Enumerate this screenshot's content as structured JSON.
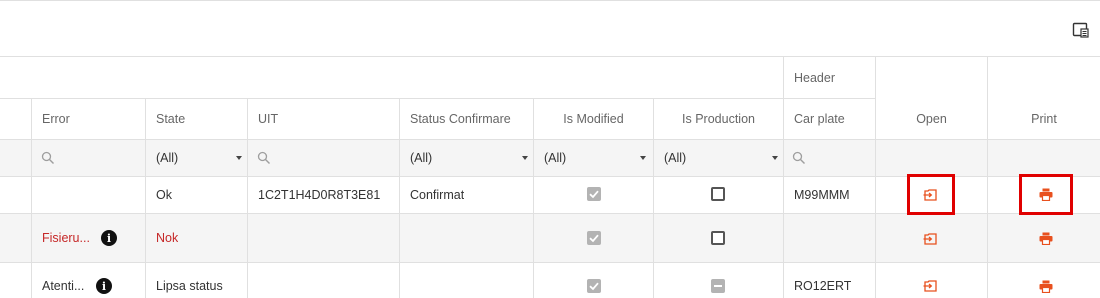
{
  "toolbar": {
    "column_chooser_icon": "column-chooser-icon"
  },
  "columns": {
    "group_header": "Header",
    "error": "Error",
    "state": "State",
    "uit": "UIT",
    "status_confirmare": "Status Confirmare",
    "is_modified": "Is Modified",
    "is_production": "Is Production",
    "car_plate": "Car plate",
    "open": "Open",
    "print": "Print"
  },
  "filters": {
    "state": "(All)",
    "status_confirmare": "(All)",
    "is_modified": "(All)",
    "is_production": "(All)"
  },
  "rows": [
    {
      "error": "",
      "state": "Ok",
      "uit": "1C2T1H4D0R8T3E81",
      "status_confirmare": "Confirmat",
      "is_modified": "checked",
      "is_production": "unchecked",
      "car_plate": "M99MMM",
      "highlighted": true
    },
    {
      "error": "Fisieru...",
      "state": "Nok",
      "uit": "",
      "status_confirmare": "",
      "is_modified": "checked",
      "is_production": "unchecked",
      "car_plate": "",
      "highlighted": false
    },
    {
      "error": "Atenti...",
      "state": "Lipsa status",
      "uit": "",
      "status_confirmare": "",
      "is_modified": "checked",
      "is_production": "indeterminate",
      "car_plate": "RO12ERT",
      "highlighted": false
    }
  ],
  "colors": {
    "accent": "#e8501e",
    "error_text": "#c62828",
    "highlight": "#e00000",
    "alt_row": "#f5f5f5",
    "border": "#e0e0e0"
  },
  "icons": {
    "info": "info-icon",
    "open": "open-document-icon",
    "print": "printer-icon",
    "search": "search-icon"
  }
}
